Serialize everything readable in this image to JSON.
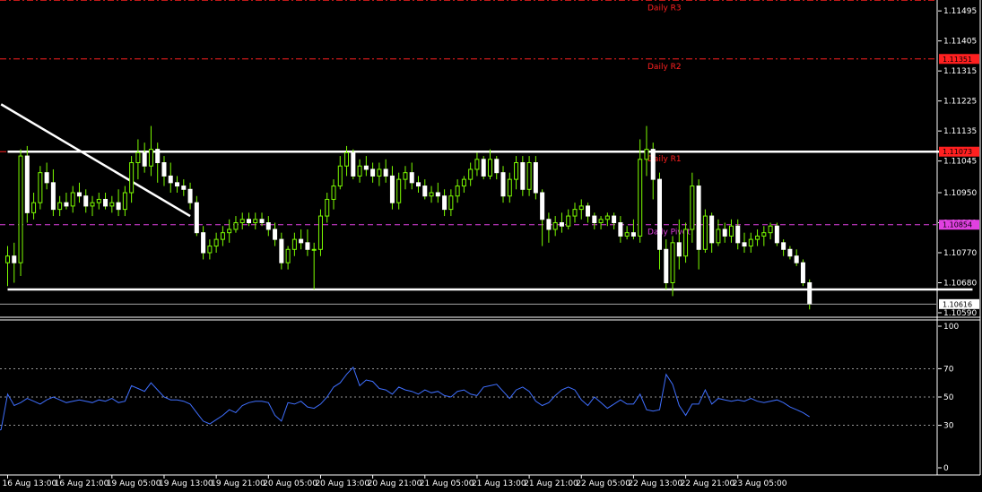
{
  "chart_data": [
    {
      "type": "candlestick",
      "panel": "price",
      "ylim": [
        1.1059,
        1.11525
      ],
      "y_ticks": [
        "1.11495",
        "1.11405",
        "1.11315",
        "1.11225",
        "1.11135",
        "1.11045",
        "1.10950",
        "1.10860",
        "1.10770",
        "1.10680",
        "1.10590"
      ],
      "levels": [
        {
          "name": "Daily R3",
          "label": "Daily R3",
          "value": 1.11527,
          "color": "#ff2020",
          "style": "dash-dot",
          "badge": ""
        },
        {
          "name": "Daily R2",
          "label": "Daily R2",
          "value": 1.11351,
          "color": "#ff2020",
          "style": "dash-dot",
          "badge": "1.11351"
        },
        {
          "name": "Daily R1",
          "label": "Daily R1",
          "value": 1.11073,
          "color": "#ff2020",
          "style": "dash-dot",
          "badge": "1.11073"
        },
        {
          "name": "Daily Pivot",
          "label": "Daily Pivot",
          "value": 1.10854,
          "color": "#e040e0",
          "style": "dash",
          "badge": "1.10854"
        }
      ],
      "current_price": {
        "value": 1.10616,
        "label": "1.10616",
        "color": "#ffffff"
      },
      "trendlines": [
        {
          "name": "resistance",
          "from": [
            0,
            1.11073
          ],
          "to": [
            143,
            1.11073
          ],
          "color": "#ffffff"
        },
        {
          "name": "support",
          "from": [
            0,
            1.1066
          ],
          "to": [
            148,
            1.1066
          ],
          "color": "#ffffff"
        },
        {
          "name": "descending",
          "from": [
            -1,
            1.11215
          ],
          "to": [
            28,
            1.1088
          ],
          "color": "#ffffff"
        }
      ],
      "time_labels": [
        {
          "label": "16 Aug 13:00",
          "index": 0
        },
        {
          "label": "16 Aug 21:00",
          "index": 8
        },
        {
          "label": "19 Aug 05:00",
          "index": 16
        },
        {
          "label": "19 Aug 13:00",
          "index": 24
        },
        {
          "label": "19 Aug 21:00",
          "index": 32
        },
        {
          "label": "20 Aug 05:00",
          "index": 40
        },
        {
          "label": "20 Aug 13:00",
          "index": 48
        },
        {
          "label": "20 Aug 21:00",
          "index": 56
        },
        {
          "label": "21 Aug 05:00",
          "index": 64
        },
        {
          "label": "21 Aug 13:00",
          "index": 72
        },
        {
          "label": "21 Aug 21:00",
          "index": 80
        },
        {
          "label": "22 Aug 05:00",
          "index": 88
        },
        {
          "label": "22 Aug 13:00",
          "index": 96
        },
        {
          "label": "22 Aug 21:00",
          "index": 104
        },
        {
          "label": "23 Aug 05:00",
          "index": 112
        }
      ],
      "candles": [
        {
          "o": 1.1074,
          "h": 1.1079,
          "l": 1.1067,
          "c": 1.1076
        },
        {
          "o": 1.1076,
          "h": 1.108,
          "l": 1.1068,
          "c": 1.1074
        },
        {
          "o": 1.1074,
          "h": 1.1108,
          "l": 1.107,
          "c": 1.1106
        },
        {
          "o": 1.1106,
          "h": 1.1109,
          "l": 1.1086,
          "c": 1.1089
        },
        {
          "o": 1.1089,
          "h": 1.1095,
          "l": 1.1087,
          "c": 1.1092
        },
        {
          "o": 1.1092,
          "h": 1.1103,
          "l": 1.109,
          "c": 1.1101
        },
        {
          "o": 1.1101,
          "h": 1.1104,
          "l": 1.1096,
          "c": 1.1098
        },
        {
          "o": 1.1098,
          "h": 1.1102,
          "l": 1.1088,
          "c": 1.109
        },
        {
          "o": 1.109,
          "h": 1.1094,
          "l": 1.1088,
          "c": 1.1092
        },
        {
          "o": 1.1092,
          "h": 1.1095,
          "l": 1.109,
          "c": 1.1091
        },
        {
          "o": 1.1091,
          "h": 1.1097,
          "l": 1.1089,
          "c": 1.1095
        },
        {
          "o": 1.1095,
          "h": 1.1098,
          "l": 1.1092,
          "c": 1.1094
        },
        {
          "o": 1.1094,
          "h": 1.1096,
          "l": 1.1089,
          "c": 1.1091
        },
        {
          "o": 1.1091,
          "h": 1.1094,
          "l": 1.1088,
          "c": 1.1092
        },
        {
          "o": 1.1092,
          "h": 1.1095,
          "l": 1.109,
          "c": 1.1093
        },
        {
          "o": 1.1093,
          "h": 1.1095,
          "l": 1.109,
          "c": 1.1091
        },
        {
          "o": 1.1091,
          "h": 1.1094,
          "l": 1.1089,
          "c": 1.1092
        },
        {
          "o": 1.1092,
          "h": 1.1096,
          "l": 1.1088,
          "c": 1.109
        },
        {
          "o": 1.109,
          "h": 1.1097,
          "l": 1.1088,
          "c": 1.1095
        },
        {
          "o": 1.1095,
          "h": 1.1106,
          "l": 1.1092,
          "c": 1.1104
        },
        {
          "o": 1.1104,
          "h": 1.1111,
          "l": 1.1099,
          "c": 1.1107
        },
        {
          "o": 1.1107,
          "h": 1.111,
          "l": 1.1101,
          "c": 1.1103
        },
        {
          "o": 1.1103,
          "h": 1.1115,
          "l": 1.11,
          "c": 1.1108
        },
        {
          "o": 1.1108,
          "h": 1.111,
          "l": 1.1098,
          "c": 1.1104
        },
        {
          "o": 1.1104,
          "h": 1.1106,
          "l": 1.1097,
          "c": 1.11
        },
        {
          "o": 1.11,
          "h": 1.1104,
          "l": 1.1095,
          "c": 1.1098
        },
        {
          "o": 1.1098,
          "h": 1.11,
          "l": 1.1095,
          "c": 1.1097
        },
        {
          "o": 1.1097,
          "h": 1.1099,
          "l": 1.1094,
          "c": 1.1096
        },
        {
          "o": 1.1096,
          "h": 1.1098,
          "l": 1.109,
          "c": 1.1092
        },
        {
          "o": 1.1092,
          "h": 1.1094,
          "l": 1.1082,
          "c": 1.1083
        },
        {
          "o": 1.1083,
          "h": 1.1085,
          "l": 1.1075,
          "c": 1.1077
        },
        {
          "o": 1.1077,
          "h": 1.1081,
          "l": 1.1075,
          "c": 1.1079
        },
        {
          "o": 1.1079,
          "h": 1.1083,
          "l": 1.1077,
          "c": 1.1081
        },
        {
          "o": 1.1081,
          "h": 1.1085,
          "l": 1.1079,
          "c": 1.1083
        },
        {
          "o": 1.1083,
          "h": 1.1087,
          "l": 1.108,
          "c": 1.1084
        },
        {
          "o": 1.1084,
          "h": 1.1088,
          "l": 1.1083,
          "c": 1.1086
        },
        {
          "o": 1.1086,
          "h": 1.1089,
          "l": 1.1084,
          "c": 1.1087
        },
        {
          "o": 1.1087,
          "h": 1.1089,
          "l": 1.1085,
          "c": 1.1086
        },
        {
          "o": 1.1086,
          "h": 1.1089,
          "l": 1.1084,
          "c": 1.1087
        },
        {
          "o": 1.1087,
          "h": 1.1089,
          "l": 1.1085,
          "c": 1.1086
        },
        {
          "o": 1.1086,
          "h": 1.1088,
          "l": 1.1082,
          "c": 1.1084
        },
        {
          "o": 1.1084,
          "h": 1.1086,
          "l": 1.1079,
          "c": 1.1081
        },
        {
          "o": 1.1081,
          "h": 1.1083,
          "l": 1.1072,
          "c": 1.1074
        },
        {
          "o": 1.1074,
          "h": 1.1079,
          "l": 1.1072,
          "c": 1.1078
        },
        {
          "o": 1.1078,
          "h": 1.1083,
          "l": 1.1076,
          "c": 1.1081
        },
        {
          "o": 1.1081,
          "h": 1.1084,
          "l": 1.1078,
          "c": 1.108
        },
        {
          "o": 1.108,
          "h": 1.1084,
          "l": 1.1076,
          "c": 1.1078
        },
        {
          "o": 1.1078,
          "h": 1.108,
          "l": 1.1066,
          "c": 1.1078
        },
        {
          "o": 1.1078,
          "h": 1.109,
          "l": 1.1076,
          "c": 1.1088
        },
        {
          "o": 1.1088,
          "h": 1.1095,
          "l": 1.1086,
          "c": 1.1093
        },
        {
          "o": 1.1093,
          "h": 1.1099,
          "l": 1.109,
          "c": 1.1097
        },
        {
          "o": 1.1097,
          "h": 1.1106,
          "l": 1.1096,
          "c": 1.1103
        },
        {
          "o": 1.1103,
          "h": 1.1109,
          "l": 1.11,
          "c": 1.1107
        },
        {
          "o": 1.1107,
          "h": 1.1108,
          "l": 1.1099,
          "c": 1.11
        },
        {
          "o": 1.11,
          "h": 1.1105,
          "l": 1.1098,
          "c": 1.1103
        },
        {
          "o": 1.1103,
          "h": 1.1106,
          "l": 1.11,
          "c": 1.1102
        },
        {
          "o": 1.1102,
          "h": 1.1104,
          "l": 1.1098,
          "c": 1.11
        },
        {
          "o": 1.11,
          "h": 1.1104,
          "l": 1.1097,
          "c": 1.1102
        },
        {
          "o": 1.1102,
          "h": 1.1105,
          "l": 1.1098,
          "c": 1.11
        },
        {
          "o": 1.11,
          "h": 1.1103,
          "l": 1.109,
          "c": 1.1092
        },
        {
          "o": 1.1092,
          "h": 1.1101,
          "l": 1.109,
          "c": 1.1099
        },
        {
          "o": 1.1099,
          "h": 1.1103,
          "l": 1.1096,
          "c": 1.1101
        },
        {
          "o": 1.1101,
          "h": 1.1104,
          "l": 1.1096,
          "c": 1.1098
        },
        {
          "o": 1.1098,
          "h": 1.11,
          "l": 1.1095,
          "c": 1.1097
        },
        {
          "o": 1.1097,
          "h": 1.1099,
          "l": 1.1093,
          "c": 1.1094
        },
        {
          "o": 1.1094,
          "h": 1.1097,
          "l": 1.1092,
          "c": 1.1095
        },
        {
          "o": 1.1095,
          "h": 1.1098,
          "l": 1.1092,
          "c": 1.1094
        },
        {
          "o": 1.1094,
          "h": 1.1096,
          "l": 1.1088,
          "c": 1.109
        },
        {
          "o": 1.109,
          "h": 1.1096,
          "l": 1.1088,
          "c": 1.1094
        },
        {
          "o": 1.1094,
          "h": 1.1099,
          "l": 1.1092,
          "c": 1.1097
        },
        {
          "o": 1.1097,
          "h": 1.11,
          "l": 1.1095,
          "c": 1.1099
        },
        {
          "o": 1.1099,
          "h": 1.1104,
          "l": 1.1097,
          "c": 1.1102
        },
        {
          "o": 1.1102,
          "h": 1.1107,
          "l": 1.11,
          "c": 1.1105
        },
        {
          "o": 1.1105,
          "h": 1.1106,
          "l": 1.1099,
          "c": 1.11
        },
        {
          "o": 1.11,
          "h": 1.1108,
          "l": 1.1099,
          "c": 1.1105
        },
        {
          "o": 1.1105,
          "h": 1.1106,
          "l": 1.1099,
          "c": 1.1101
        },
        {
          "o": 1.1101,
          "h": 1.1103,
          "l": 1.1092,
          "c": 1.1094
        },
        {
          "o": 1.1094,
          "h": 1.1101,
          "l": 1.1092,
          "c": 1.1099
        },
        {
          "o": 1.1099,
          "h": 1.1106,
          "l": 1.1096,
          "c": 1.1104
        },
        {
          "o": 1.1104,
          "h": 1.1106,
          "l": 1.1094,
          "c": 1.1096
        },
        {
          "o": 1.1096,
          "h": 1.1106,
          "l": 1.1094,
          "c": 1.1104
        },
        {
          "o": 1.1104,
          "h": 1.1106,
          "l": 1.1093,
          "c": 1.1095
        },
        {
          "o": 1.1095,
          "h": 1.1096,
          "l": 1.1079,
          "c": 1.1087
        },
        {
          "o": 1.1087,
          "h": 1.1089,
          "l": 1.108,
          "c": 1.1084
        },
        {
          "o": 1.1084,
          "h": 1.1088,
          "l": 1.1082,
          "c": 1.1086
        },
        {
          "o": 1.1086,
          "h": 1.1089,
          "l": 1.1083,
          "c": 1.1085
        },
        {
          "o": 1.1085,
          "h": 1.109,
          "l": 1.1084,
          "c": 1.1088
        },
        {
          "o": 1.1088,
          "h": 1.1092,
          "l": 1.1086,
          "c": 1.109
        },
        {
          "o": 1.109,
          "h": 1.1093,
          "l": 1.1087,
          "c": 1.1091
        },
        {
          "o": 1.1091,
          "h": 1.1092,
          "l": 1.1086,
          "c": 1.1088
        },
        {
          "o": 1.1088,
          "h": 1.1089,
          "l": 1.1084,
          "c": 1.1086
        },
        {
          "o": 1.1086,
          "h": 1.1088,
          "l": 1.1084,
          "c": 1.1087
        },
        {
          "o": 1.1087,
          "h": 1.1089,
          "l": 1.1085,
          "c": 1.1088
        },
        {
          "o": 1.1088,
          "h": 1.1089,
          "l": 1.1084,
          "c": 1.1086
        },
        {
          "o": 1.1086,
          "h": 1.1088,
          "l": 1.108,
          "c": 1.1082
        },
        {
          "o": 1.1082,
          "h": 1.1085,
          "l": 1.1081,
          "c": 1.1083
        },
        {
          "o": 1.1083,
          "h": 1.1087,
          "l": 1.1081,
          "c": 1.1082
        },
        {
          "o": 1.1082,
          "h": 1.1111,
          "l": 1.108,
          "c": 1.1105
        },
        {
          "o": 1.1105,
          "h": 1.1115,
          "l": 1.11,
          "c": 1.1108
        },
        {
          "o": 1.1108,
          "h": 1.111,
          "l": 1.1093,
          "c": 1.1099
        },
        {
          "o": 1.1099,
          "h": 1.1101,
          "l": 1.1072,
          "c": 1.1078
        },
        {
          "o": 1.1078,
          "h": 1.1081,
          "l": 1.1066,
          "c": 1.1068
        },
        {
          "o": 1.1068,
          "h": 1.1082,
          "l": 1.1064,
          "c": 1.108
        },
        {
          "o": 1.108,
          "h": 1.1087,
          "l": 1.1072,
          "c": 1.1076
        },
        {
          "o": 1.1076,
          "h": 1.1086,
          "l": 1.1074,
          "c": 1.1084
        },
        {
          "o": 1.1084,
          "h": 1.1101,
          "l": 1.108,
          "c": 1.1097
        },
        {
          "o": 1.1097,
          "h": 1.1099,
          "l": 1.1072,
          "c": 1.1078
        },
        {
          "o": 1.1078,
          "h": 1.109,
          "l": 1.1077,
          "c": 1.1088
        },
        {
          "o": 1.1088,
          "h": 1.1089,
          "l": 1.1077,
          "c": 1.108
        },
        {
          "o": 1.108,
          "h": 1.1087,
          "l": 1.1079,
          "c": 1.1084
        },
        {
          "o": 1.1084,
          "h": 1.1086,
          "l": 1.108,
          "c": 1.1082
        },
        {
          "o": 1.1082,
          "h": 1.1087,
          "l": 1.108,
          "c": 1.1085
        },
        {
          "o": 1.1085,
          "h": 1.1087,
          "l": 1.1078,
          "c": 1.108
        },
        {
          "o": 1.108,
          "h": 1.1083,
          "l": 1.1077,
          "c": 1.1079
        },
        {
          "o": 1.1079,
          "h": 1.1083,
          "l": 1.1077,
          "c": 1.1081
        },
        {
          "o": 1.1081,
          "h": 1.1084,
          "l": 1.1079,
          "c": 1.1082
        },
        {
          "o": 1.1082,
          "h": 1.1085,
          "l": 1.1079,
          "c": 1.1083
        },
        {
          "o": 1.1083,
          "h": 1.1086,
          "l": 1.1081,
          "c": 1.1085
        },
        {
          "o": 1.1085,
          "h": 1.1086,
          "l": 1.1079,
          "c": 1.108
        },
        {
          "o": 1.108,
          "h": 1.1081,
          "l": 1.1076,
          "c": 1.1078
        },
        {
          "o": 1.1078,
          "h": 1.1079,
          "l": 1.1075,
          "c": 1.1076
        },
        {
          "o": 1.1076,
          "h": 1.1078,
          "l": 1.1073,
          "c": 1.1074
        },
        {
          "o": 1.1074,
          "h": 1.1075,
          "l": 1.1067,
          "c": 1.1068
        },
        {
          "o": 1.1068,
          "h": 1.1069,
          "l": 1.106,
          "c": 1.10616
        }
      ]
    },
    {
      "type": "line",
      "panel": "oscillator",
      "ylim": [
        0,
        100
      ],
      "y_ticks": [
        "100",
        "70",
        "50",
        "30",
        "0"
      ],
      "levels": [
        70,
        50,
        30
      ],
      "series": [
        {
          "color": "#3f6fff",
          "values": [
            27,
            25,
            27,
            52,
            44,
            46,
            49,
            47,
            45,
            48,
            50,
            48,
            46,
            47,
            48,
            47,
            46,
            48,
            47,
            49,
            46,
            47,
            58,
            56,
            54,
            60,
            55,
            50,
            48,
            48,
            47,
            45,
            39,
            33,
            31,
            34,
            37,
            41,
            39,
            44,
            46,
            47,
            47,
            46,
            37,
            33,
            46,
            45,
            47,
            43,
            42,
            45,
            50,
            57,
            60,
            66,
            71,
            58,
            62,
            61,
            56,
            55,
            52,
            57,
            55,
            54,
            52,
            55,
            53,
            54,
            51,
            50,
            54,
            55,
            52,
            51,
            57,
            58,
            59,
            54,
            49,
            55,
            57,
            54,
            47,
            44,
            46,
            51,
            55,
            57,
            55,
            48,
            44,
            50,
            46,
            42,
            45,
            48,
            45,
            45,
            52,
            41,
            40,
            41,
            66,
            59,
            44,
            37,
            45,
            45,
            55,
            45,
            49,
            48,
            47,
            48,
            47,
            49,
            47,
            46,
            47,
            48,
            46,
            43,
            41,
            39,
            36
          ],
          "values_start_index": -3
        }
      ]
    }
  ]
}
